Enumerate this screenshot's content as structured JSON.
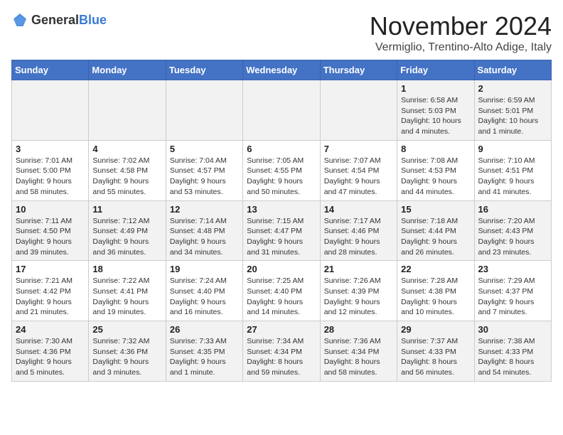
{
  "logo": {
    "general": "General",
    "blue": "Blue"
  },
  "header": {
    "month": "November 2024",
    "location": "Vermiglio, Trentino-Alto Adige, Italy"
  },
  "weekdays": [
    "Sunday",
    "Monday",
    "Tuesday",
    "Wednesday",
    "Thursday",
    "Friday",
    "Saturday"
  ],
  "weeks": [
    [
      {
        "day": "",
        "info": ""
      },
      {
        "day": "",
        "info": ""
      },
      {
        "day": "",
        "info": ""
      },
      {
        "day": "",
        "info": ""
      },
      {
        "day": "",
        "info": ""
      },
      {
        "day": "1",
        "info": "Sunrise: 6:58 AM\nSunset: 5:03 PM\nDaylight: 10 hours and 4 minutes."
      },
      {
        "day": "2",
        "info": "Sunrise: 6:59 AM\nSunset: 5:01 PM\nDaylight: 10 hours and 1 minute."
      }
    ],
    [
      {
        "day": "3",
        "info": "Sunrise: 7:01 AM\nSunset: 5:00 PM\nDaylight: 9 hours and 58 minutes."
      },
      {
        "day": "4",
        "info": "Sunrise: 7:02 AM\nSunset: 4:58 PM\nDaylight: 9 hours and 55 minutes."
      },
      {
        "day": "5",
        "info": "Sunrise: 7:04 AM\nSunset: 4:57 PM\nDaylight: 9 hours and 53 minutes."
      },
      {
        "day": "6",
        "info": "Sunrise: 7:05 AM\nSunset: 4:55 PM\nDaylight: 9 hours and 50 minutes."
      },
      {
        "day": "7",
        "info": "Sunrise: 7:07 AM\nSunset: 4:54 PM\nDaylight: 9 hours and 47 minutes."
      },
      {
        "day": "8",
        "info": "Sunrise: 7:08 AM\nSunset: 4:53 PM\nDaylight: 9 hours and 44 minutes."
      },
      {
        "day": "9",
        "info": "Sunrise: 7:10 AM\nSunset: 4:51 PM\nDaylight: 9 hours and 41 minutes."
      }
    ],
    [
      {
        "day": "10",
        "info": "Sunrise: 7:11 AM\nSunset: 4:50 PM\nDaylight: 9 hours and 39 minutes."
      },
      {
        "day": "11",
        "info": "Sunrise: 7:12 AM\nSunset: 4:49 PM\nDaylight: 9 hours and 36 minutes."
      },
      {
        "day": "12",
        "info": "Sunrise: 7:14 AM\nSunset: 4:48 PM\nDaylight: 9 hours and 34 minutes."
      },
      {
        "day": "13",
        "info": "Sunrise: 7:15 AM\nSunset: 4:47 PM\nDaylight: 9 hours and 31 minutes."
      },
      {
        "day": "14",
        "info": "Sunrise: 7:17 AM\nSunset: 4:46 PM\nDaylight: 9 hours and 28 minutes."
      },
      {
        "day": "15",
        "info": "Sunrise: 7:18 AM\nSunset: 4:44 PM\nDaylight: 9 hours and 26 minutes."
      },
      {
        "day": "16",
        "info": "Sunrise: 7:20 AM\nSunset: 4:43 PM\nDaylight: 9 hours and 23 minutes."
      }
    ],
    [
      {
        "day": "17",
        "info": "Sunrise: 7:21 AM\nSunset: 4:42 PM\nDaylight: 9 hours and 21 minutes."
      },
      {
        "day": "18",
        "info": "Sunrise: 7:22 AM\nSunset: 4:41 PM\nDaylight: 9 hours and 19 minutes."
      },
      {
        "day": "19",
        "info": "Sunrise: 7:24 AM\nSunset: 4:40 PM\nDaylight: 9 hours and 16 minutes."
      },
      {
        "day": "20",
        "info": "Sunrise: 7:25 AM\nSunset: 4:40 PM\nDaylight: 9 hours and 14 minutes."
      },
      {
        "day": "21",
        "info": "Sunrise: 7:26 AM\nSunset: 4:39 PM\nDaylight: 9 hours and 12 minutes."
      },
      {
        "day": "22",
        "info": "Sunrise: 7:28 AM\nSunset: 4:38 PM\nDaylight: 9 hours and 10 minutes."
      },
      {
        "day": "23",
        "info": "Sunrise: 7:29 AM\nSunset: 4:37 PM\nDaylight: 9 hours and 7 minutes."
      }
    ],
    [
      {
        "day": "24",
        "info": "Sunrise: 7:30 AM\nSunset: 4:36 PM\nDaylight: 9 hours and 5 minutes."
      },
      {
        "day": "25",
        "info": "Sunrise: 7:32 AM\nSunset: 4:36 PM\nDaylight: 9 hours and 3 minutes."
      },
      {
        "day": "26",
        "info": "Sunrise: 7:33 AM\nSunset: 4:35 PM\nDaylight: 9 hours and 1 minute."
      },
      {
        "day": "27",
        "info": "Sunrise: 7:34 AM\nSunset: 4:34 PM\nDaylight: 8 hours and 59 minutes."
      },
      {
        "day": "28",
        "info": "Sunrise: 7:36 AM\nSunset: 4:34 PM\nDaylight: 8 hours and 58 minutes."
      },
      {
        "day": "29",
        "info": "Sunrise: 7:37 AM\nSunset: 4:33 PM\nDaylight: 8 hours and 56 minutes."
      },
      {
        "day": "30",
        "info": "Sunrise: 7:38 AM\nSunset: 4:33 PM\nDaylight: 8 hours and 54 minutes."
      }
    ]
  ]
}
